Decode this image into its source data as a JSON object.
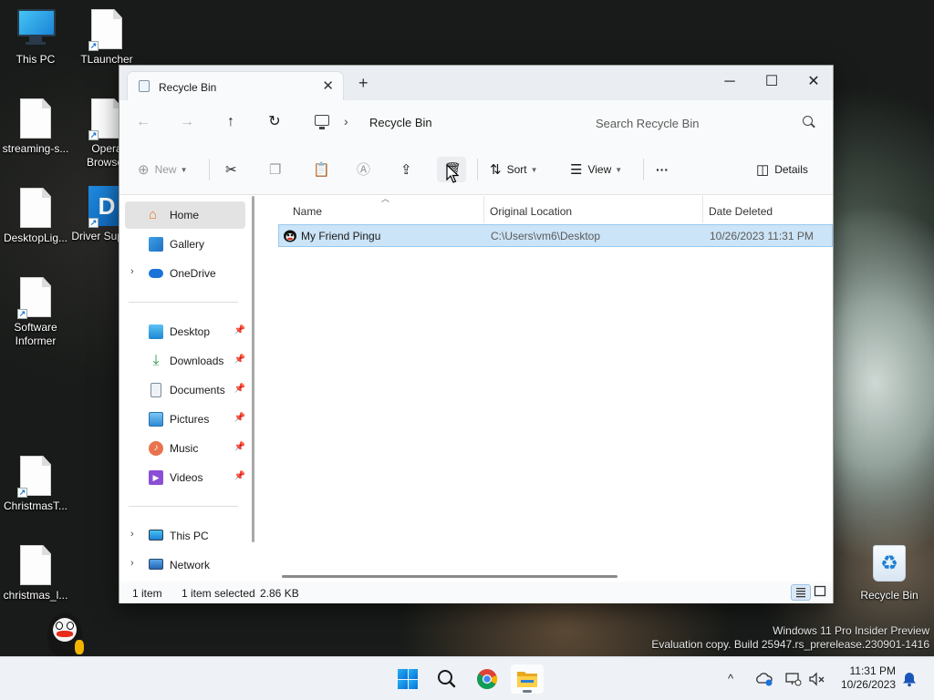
{
  "desktop": {
    "icons": [
      {
        "label": "This PC"
      },
      {
        "label": "TLauncher"
      },
      {
        "label": "streaming-s..."
      },
      {
        "label": "Opera Browser"
      },
      {
        "label": "DesktopLig..."
      },
      {
        "label": "Driver Support"
      },
      {
        "label": "Software Informer"
      },
      {
        "label": "ChristmasT..."
      },
      {
        "label": "christmas_l..."
      },
      {
        "label": "Recycle Bin"
      }
    ],
    "watermark_line1": "Windows 11 Pro Insider Preview",
    "watermark_line2": "Evaluation copy. Build 25947.rs_prerelease.230901-1416"
  },
  "window": {
    "tab_title": "Recycle Bin",
    "tab_close": "✕",
    "new_tab": "+",
    "controls": {
      "minimize": "─",
      "maximize": "☐",
      "close": "✕"
    },
    "nav": {
      "back": "←",
      "forward": "→",
      "up": "↑",
      "refresh": "↻"
    },
    "breadcrumb": {
      "chevron": "›",
      "current": "Recycle Bin"
    },
    "search": {
      "placeholder": "Search Recycle Bin"
    },
    "toolbar": {
      "new_label": "New",
      "sort_label": "Sort",
      "view_label": "View",
      "more_label": "···",
      "details_label": "Details"
    },
    "navpane": {
      "items": [
        {
          "label": "Home"
        },
        {
          "label": "Gallery"
        },
        {
          "label": "OneDrive"
        },
        {
          "label": "Desktop"
        },
        {
          "label": "Downloads"
        },
        {
          "label": "Documents"
        },
        {
          "label": "Pictures"
        },
        {
          "label": "Music"
        },
        {
          "label": "Videos"
        },
        {
          "label": "This PC"
        },
        {
          "label": "Network"
        }
      ]
    },
    "columns": {
      "name": "Name",
      "original_location": "Original Location",
      "date_deleted": "Date Deleted"
    },
    "rows": [
      {
        "name": "My Friend Pingu",
        "original_location": "C:\\Users\\vm6\\Desktop",
        "date_deleted": "10/26/2023 11:31 PM"
      }
    ],
    "status": {
      "count": "1 item",
      "selected": "1 item selected",
      "size": "2.86 KB"
    }
  },
  "taskbar": {
    "time": "11:31 PM",
    "date": "10/26/2023",
    "tray_chevron": "^"
  },
  "colors": {
    "accent": "#0067c0",
    "selection": "#cce4f7",
    "taskbar": "#eef2f6"
  }
}
